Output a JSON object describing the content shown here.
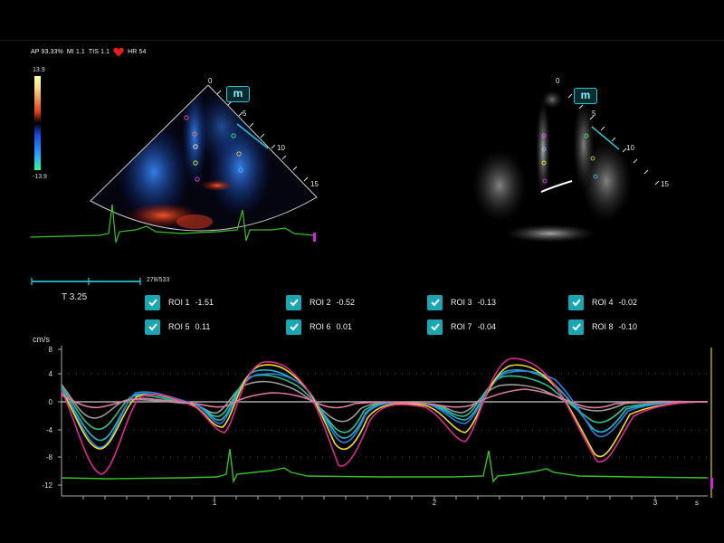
{
  "header": {
    "ap": "AP 93.33%",
    "mi": "MI 1.1",
    "tis": "TIS 1.1",
    "hr": "HR 54"
  },
  "color_scale": {
    "max": "13.9",
    "min": "-13.9"
  },
  "views": {
    "left": {
      "badge": "m",
      "depth_ticks": [
        "0",
        "5",
        "10",
        "15"
      ]
    },
    "right": {
      "badge": "m",
      "depth_ticks": [
        "0",
        "5",
        "10",
        "15"
      ]
    }
  },
  "playback": {
    "frame_counter": "278/533",
    "time_label": "T 3.25",
    "position": 0.52
  },
  "rois": [
    {
      "label": "ROI 1",
      "value": "-1.51",
      "checked": true
    },
    {
      "label": "ROI 2",
      "value": "-0.52",
      "checked": true
    },
    {
      "label": "ROI 3",
      "value": "-0.13",
      "checked": true
    },
    {
      "label": "ROI 4",
      "value": "-0.02",
      "checked": true
    },
    {
      "label": "ROI 5",
      "value": "0.11",
      "checked": true
    },
    {
      "label": "ROI 6",
      "value": "0.01",
      "checked": true
    },
    {
      "label": "ROI 7",
      "value": "-0.04",
      "checked": true
    },
    {
      "label": "ROI 8",
      "value": "-0.10",
      "checked": true
    }
  ],
  "velocity_chart": {
    "unit": "cm/s",
    "y_ticks": [
      "8",
      "4",
      "0",
      "-4",
      "-8",
      "-12"
    ],
    "x_ticks": [
      "1",
      "2",
      "3"
    ],
    "x_unit": "s",
    "colors": {
      "magenta": "#e0288e",
      "yellow": "#f0e020",
      "blue": "#2a7fe0",
      "cyan": "#22b6c8",
      "teal": "#30c090",
      "pink": "#e07aa0",
      "green_ecg": "#38c028",
      "gray": "#9a9a9a"
    }
  }
}
